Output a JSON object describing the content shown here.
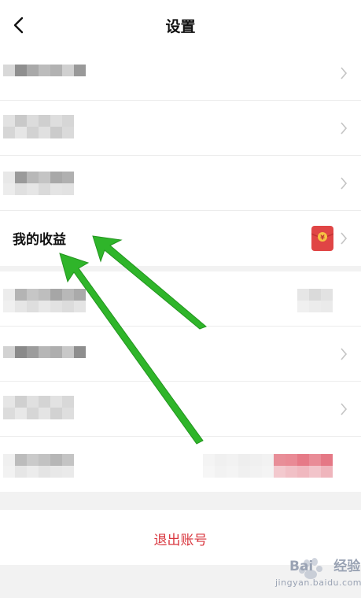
{
  "header": {
    "title": "设置",
    "back_icon": "chevron-left-icon"
  },
  "earnings_row": {
    "label": "我的收益",
    "badge_icon": "red-envelope-icon",
    "badge_symbol": "¥"
  },
  "logout": {
    "label": "退出账号"
  },
  "watermark": {
    "brand": "Bai",
    "brand_suffix": "经验",
    "sub": "jingyan.baidu.com"
  },
  "colors": {
    "accent_red": "#d9363e",
    "arrow_green": "#2fb52a",
    "envelope": "#e04545"
  }
}
